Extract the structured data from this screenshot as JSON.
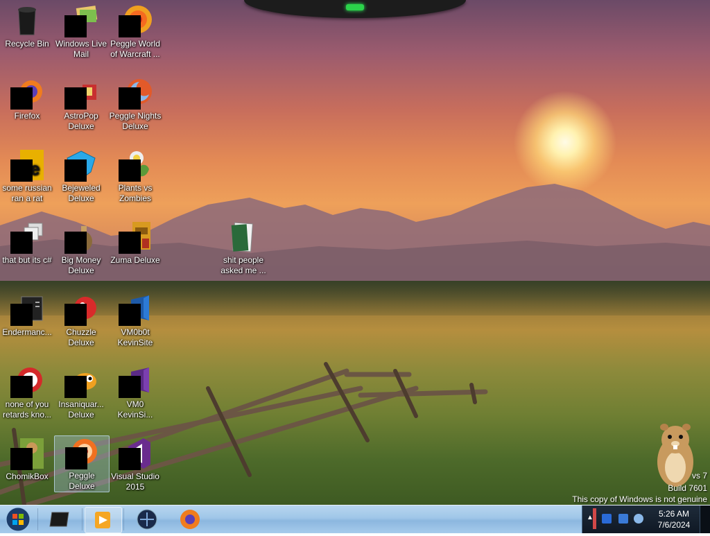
{
  "desktop": {
    "icons": [
      {
        "label": "Recycle Bin"
      },
      {
        "label": "Windows Live Mail"
      },
      {
        "label": "Peggle World of Warcraft ..."
      },
      {
        "label": "Firefox"
      },
      {
        "label": "AstroPop Deluxe"
      },
      {
        "label": "Peggle Nights Deluxe"
      },
      {
        "label": "some russian ran a rat"
      },
      {
        "label": "Bejeweled Deluxe"
      },
      {
        "label": "Plants vs Zombies"
      },
      {
        "label": "that but its c#"
      },
      {
        "label": "Big Money Deluxe"
      },
      {
        "label": "Zuma Deluxe"
      },
      {
        "label": "shit people asked me ..."
      },
      {
        "label": "Endermanc..."
      },
      {
        "label": "Chuzzle Deluxe"
      },
      {
        "label": "VM0b0t KevinSite"
      },
      {
        "label": "none of you retards kno..."
      },
      {
        "label": "Insaniquar... Deluxe"
      },
      {
        "label": "VM0 KevinSi..."
      },
      {
        "label": "ChomikBox"
      },
      {
        "label": "Peggle Deluxe"
      },
      {
        "label": "Visual Studio 2015"
      }
    ]
  },
  "watermark": {
    "line1": "vs 7",
    "line2": "Build 7601",
    "line3": "This copy of Windows is not genuine"
  },
  "taskbar": {
    "items": [
      "start-orb-icon",
      "vmware-icon",
      "media-player-icon",
      "world-of-warcraft-icon",
      "firefox-icon"
    ],
    "clock": {
      "time": "5:26 AM",
      "date": "7/6/2024"
    }
  },
  "colors": {
    "taskbar": "#a6cbeb",
    "tray": "#0f1824",
    "gadget_led": "#2bd34a"
  }
}
